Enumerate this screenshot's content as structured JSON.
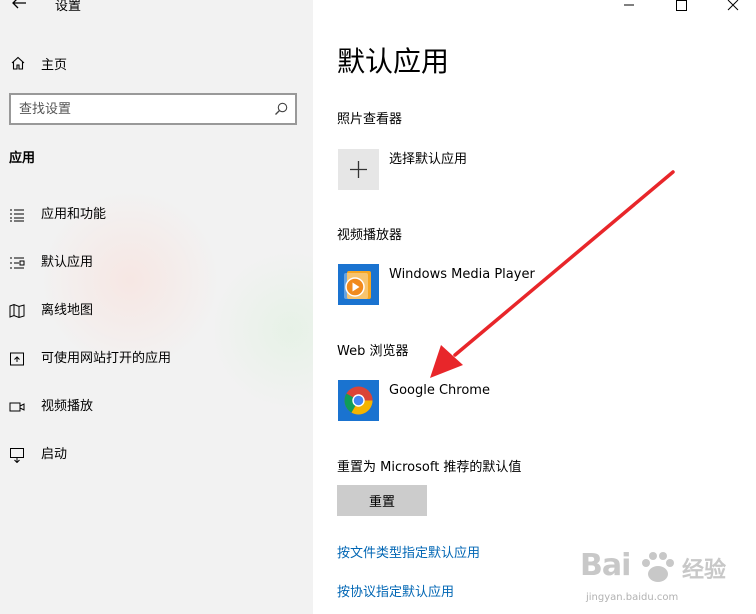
{
  "window": {
    "title": "设置",
    "controls": [
      "minimize-icon",
      "maximize-icon",
      "close-icon"
    ]
  },
  "sidebar": {
    "home_label": "主页",
    "search_placeholder": "查找设置",
    "section_title": "应用",
    "items": [
      {
        "label": "应用和功能",
        "icon": "apps-list-icon"
      },
      {
        "label": "默认应用",
        "icon": "default-apps-icon"
      },
      {
        "label": "离线地图",
        "icon": "offline-map-icon"
      },
      {
        "label": "可使用网站打开的应用",
        "icon": "open-with-website-icon"
      },
      {
        "label": "视频播放",
        "icon": "video-playback-icon"
      },
      {
        "label": "启动",
        "icon": "startup-icon"
      }
    ]
  },
  "main": {
    "title": "默认应用",
    "categories": [
      {
        "label": "照片查看器",
        "app": "选择默认应用",
        "icon": "plus-icon"
      },
      {
        "label": "视频播放器",
        "app": "Windows Media Player",
        "icon": "windows-media-player-icon"
      },
      {
        "label": "Web 浏览器",
        "app": "Google Chrome",
        "icon": "google-chrome-icon"
      }
    ],
    "reset_label": "重置为 Microsoft 推荐的默认值",
    "reset_button": "重置",
    "links": [
      "按文件类型指定默认应用",
      "按协议指定默认应用"
    ]
  },
  "watermark": {
    "brand": "Bai",
    "brand_cn": "经验",
    "url": "jingyan.baidu.com"
  },
  "colors": {
    "accent": "#0078d7",
    "link": "#0066b4",
    "annotation_arrow": "#e8262a"
  }
}
